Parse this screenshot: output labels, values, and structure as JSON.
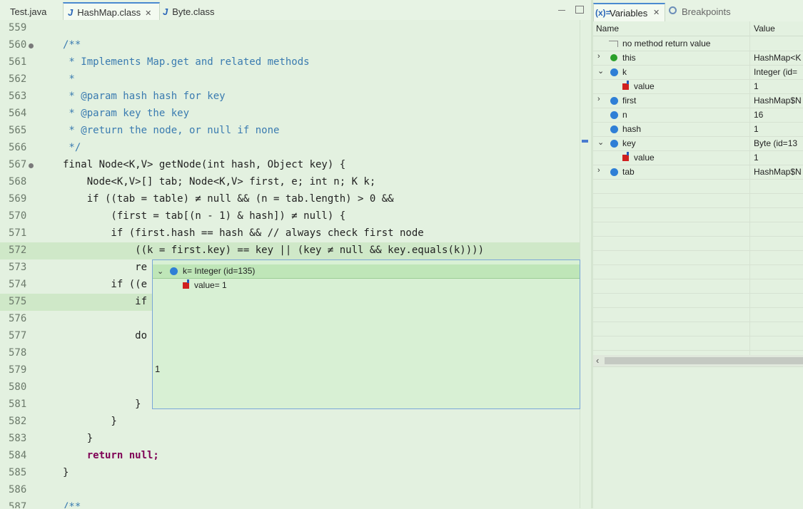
{
  "editor": {
    "tabs": [
      {
        "label": "Test.java"
      },
      {
        "label": "HashMap.class",
        "active": true
      },
      {
        "label": "Byte.class"
      }
    ],
    "lines": [
      {
        "n": "559"
      },
      {
        "n": "560",
        "c": "/**"
      },
      {
        "n": "561",
        "c": " * Implements Map.get and related methods"
      },
      {
        "n": "562",
        "c": " *"
      },
      {
        "n": "563",
        "c": " * @param hash hash for key"
      },
      {
        "n": "564",
        "c": " * @param key the key"
      },
      {
        "n": "565",
        "c": " * @return the node, or null if none"
      },
      {
        "n": "566",
        "c": " */"
      },
      {
        "n": "567",
        "c": "final Node<K,V> getNode(int hash, Object key) {"
      },
      {
        "n": "568",
        "c": "    Node<K,V>[] tab; Node<K,V> first, e; int n; K k;"
      },
      {
        "n": "569",
        "c": "    if ((tab = table) ≠ null && (n = tab.length) > 0 &&"
      },
      {
        "n": "570",
        "c": "        (first = tab[(n - 1) & hash]) ≠ null) {"
      },
      {
        "n": "571",
        "c": "        if (first.hash == hash && // always check first node"
      },
      {
        "n": "572",
        "c": "            ((k = first.key) == key || (key ≠ null && key.equals(k))))"
      },
      {
        "n": "573",
        "c": "            re"
      },
      {
        "n": "574",
        "c": "        if ((e"
      },
      {
        "n": "575",
        "c": "            if"
      },
      {
        "n": "576"
      },
      {
        "n": "577",
        "c": "            do"
      },
      {
        "n": "578"
      },
      {
        "n": "579"
      },
      {
        "n": "580"
      },
      {
        "n": "581",
        "c": "            }"
      },
      {
        "n": "582",
        "c": "        }"
      },
      {
        "n": "583",
        "c": "    }"
      },
      {
        "n": "584",
        "c": "    return null;"
      },
      {
        "n": "585",
        "c": "}"
      },
      {
        "n": "586"
      },
      {
        "n": "587",
        "c": "/**"
      }
    ]
  },
  "hover": {
    "header": "k= Integer  (id=135)",
    "value_row": "value= 1",
    "detail": "1"
  },
  "variables_view": {
    "tabs": {
      "variables": "Variables",
      "breakpoints": "Breakpoints"
    },
    "columns": {
      "name": "Name",
      "value": "Value"
    },
    "rows": [
      {
        "name": "no method return value",
        "value": ""
      },
      {
        "name": "this",
        "value": "HashMap<K"
      },
      {
        "name": "k",
        "value": "Integer  (id="
      },
      {
        "name": "value",
        "value": "1"
      },
      {
        "name": "first",
        "value": "HashMap$N"
      },
      {
        "name": "n",
        "value": "16"
      },
      {
        "name": "hash",
        "value": "1"
      },
      {
        "name": "key",
        "value": "Byte  (id=13"
      },
      {
        "name": "value",
        "value": "1"
      },
      {
        "name": "tab",
        "value": "HashMap$N"
      }
    ]
  },
  "colors": {
    "background": "#e3f1e0",
    "highlight": "#cfe8c8",
    "keyword": "#7f0055",
    "comment": "#3a7bb0"
  }
}
